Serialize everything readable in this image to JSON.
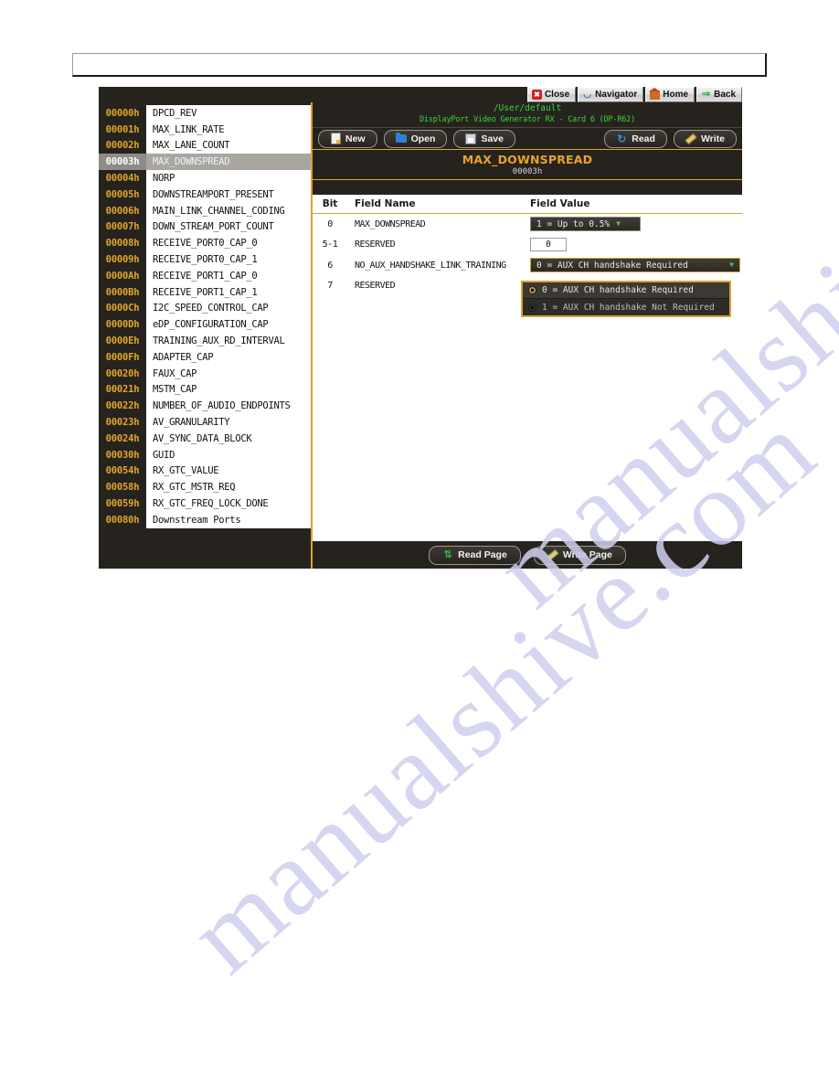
{
  "header_box": {
    "text": ""
  },
  "watermark": {
    "text": "manualshive.com"
  },
  "topnav": {
    "buttons": [
      {
        "label": "Close",
        "icon": "close-icon"
      },
      {
        "label": "Navigator",
        "icon": "navigator-icon"
      },
      {
        "label": "Home",
        "icon": "home-icon"
      },
      {
        "label": "Back",
        "icon": "back-arrow-icon"
      }
    ]
  },
  "sidebar": {
    "registers": [
      {
        "addr": "00000h",
        "name": "DPCD_REV",
        "selected": false
      },
      {
        "addr": "00001h",
        "name": "MAX_LINK_RATE",
        "selected": false
      },
      {
        "addr": "00002h",
        "name": "MAX_LANE_COUNT",
        "selected": false
      },
      {
        "addr": "00003h",
        "name": "MAX_DOWNSPREAD",
        "selected": true
      },
      {
        "addr": "00004h",
        "name": "NORP",
        "selected": false
      },
      {
        "addr": "00005h",
        "name": "DOWNSTREAMPORT_PRESENT",
        "selected": false
      },
      {
        "addr": "00006h",
        "name": "MAIN_LINK_CHANNEL_CODING",
        "selected": false
      },
      {
        "addr": "00007h",
        "name": "DOWN_STREAM_PORT_COUNT",
        "selected": false
      },
      {
        "addr": "00008h",
        "name": "RECEIVE_PORT0_CAP_0",
        "selected": false
      },
      {
        "addr": "00009h",
        "name": "RECEIVE_PORT0_CAP_1",
        "selected": false
      },
      {
        "addr": "0000Ah",
        "name": "RECEIVE_PORT1_CAP_0",
        "selected": false
      },
      {
        "addr": "0000Bh",
        "name": "RECEIVE_PORT1_CAP_1",
        "selected": false
      },
      {
        "addr": "0000Ch",
        "name": "I2C_SPEED_CONTROL_CAP",
        "selected": false
      },
      {
        "addr": "0000Dh",
        "name": "eDP_CONFIGURATION_CAP",
        "selected": false
      },
      {
        "addr": "0000Eh",
        "name": "TRAINING_AUX_RD_INTERVAL",
        "selected": false
      },
      {
        "addr": "0000Fh",
        "name": "ADAPTER_CAP",
        "selected": false
      },
      {
        "addr": "00020h",
        "name": "FAUX_CAP",
        "selected": false
      },
      {
        "addr": "00021h",
        "name": "MSTM_CAP",
        "selected": false
      },
      {
        "addr": "00022h",
        "name": "NUMBER_OF_AUDIO_ENDPOINTS",
        "selected": false
      },
      {
        "addr": "00023h",
        "name": "AV_GRANULARITY",
        "selected": false
      },
      {
        "addr": "00024h",
        "name": "AV_SYNC_DATA_BLOCK",
        "selected": false
      },
      {
        "addr": "00030h",
        "name": "GUID",
        "selected": false
      },
      {
        "addr": "00054h",
        "name": "RX_GTC_VALUE",
        "selected": false
      },
      {
        "addr": "00058h",
        "name": "RX_GTC_MSTR_REQ",
        "selected": false
      },
      {
        "addr": "00059h",
        "name": "RX_GTC_FREQ_LOCK_DONE",
        "selected": false
      },
      {
        "addr": "00080h",
        "name": "Downstream Ports",
        "selected": false
      }
    ]
  },
  "panel": {
    "path": "/User/default",
    "device": "DisplayPort Video Generator RX - Card 6  (DP-R62)",
    "file_buttons": [
      {
        "label": "New",
        "icon": "new-document-icon"
      },
      {
        "label": "Open",
        "icon": "open-folder-icon"
      },
      {
        "label": "Save",
        "icon": "save-disk-icon"
      }
    ],
    "action_buttons": [
      {
        "label": "Read",
        "icon": "refresh-icon"
      },
      {
        "label": "Write",
        "icon": "pencil-icon"
      }
    ],
    "register_title": "MAX_DOWNSPREAD",
    "register_address": "00003h",
    "table": {
      "headers": {
        "bit": "Bit",
        "field_name": "Field Name",
        "field_value": "Field Value"
      },
      "rows": [
        {
          "bit": "0",
          "name": "MAX_DOWNSPREAD",
          "value": "1 = Up to 0.5%",
          "widget": "combo-small"
        },
        {
          "bit": "5-1",
          "name": "RESERVED",
          "value": "0",
          "widget": "textbox"
        },
        {
          "bit": "6",
          "name": "NO_AUX_HANDSHAKE_LINK_TRAINING",
          "value": "0 = AUX CH handshake Required",
          "widget": "combo-wide-open"
        },
        {
          "bit": "7",
          "name": "RESERVED",
          "value": "",
          "widget": "none"
        }
      ]
    },
    "dropdown": {
      "options": [
        {
          "label": "0 = AUX CH handshake Required",
          "selected": true
        },
        {
          "label": "1 = AUX CH handshake Not Required",
          "selected": false
        }
      ]
    },
    "footer_buttons": [
      {
        "label": "Read Page",
        "icon": "sync-icon"
      },
      {
        "label": "Write Page",
        "icon": "pencil-icon"
      }
    ]
  },
  "colors": {
    "accent_gold": "#d6a431",
    "addr_text": "#e0a62a",
    "terminal_green": "#3ad43a",
    "panel_bg": "#26231f",
    "title_gold": "#e8a32b"
  }
}
